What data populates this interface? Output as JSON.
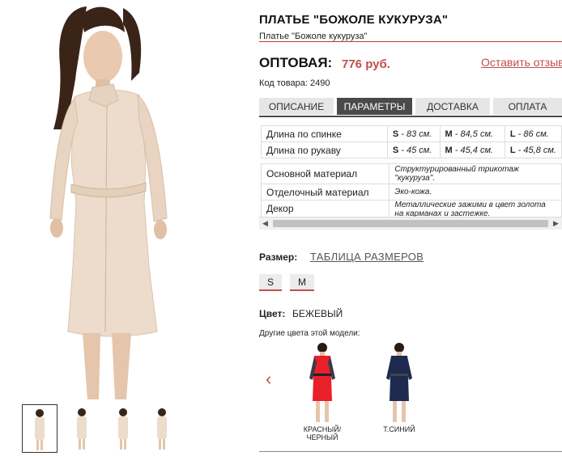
{
  "product": {
    "title": "ПЛАТЬЕ \"БОЖОЛЕ КУКУРУЗА\"",
    "subtitle": "Платье \"Божоле кукуруза\"",
    "price_label": "ОПТОВАЯ:",
    "price_value": "776 руб.",
    "review_link": "Оставить отзыв",
    "sku": "Код товара: 2490"
  },
  "tabs": [
    {
      "label": "ОПИСАНИЕ",
      "active": false
    },
    {
      "label": "ПАРАМЕТРЫ",
      "active": true
    },
    {
      "label": "ДОСТАВКА",
      "active": false
    },
    {
      "label": "ОПЛАТА",
      "active": false
    }
  ],
  "params": {
    "measurements": [
      {
        "label": "Длина по спинке",
        "s_size": "S",
        "s_val": " - 83 см.",
        "m_size": "M",
        "m_val": " - 84,5 см.",
        "l_size": "L",
        "l_val": " - 86 см."
      },
      {
        "label": "Длина по рукаву",
        "s_size": "S",
        "s_val": " - 45 см.",
        "m_size": "M",
        "m_val": " - 45,4 см.",
        "l_size": "L",
        "l_val": " - 45,8 см."
      }
    ],
    "details": [
      {
        "label": "Основной материал",
        "value": "Структурированный трикотаж \"кукуруза\"."
      },
      {
        "label": "Отделочный материал",
        "value": "Эко-кожа."
      },
      {
        "label": "Декор",
        "value": "Металлические зажими в цвет золота на карманах и застежке."
      }
    ]
  },
  "size": {
    "label": "Размер:",
    "table_link": "ТАБЛИЦА РАЗМЕРОВ",
    "options": [
      "S",
      "M"
    ]
  },
  "color": {
    "label": "Цвет:",
    "value": "БЕЖЕВЫЙ",
    "other_label": "Другие цвета этой модели:",
    "variants": [
      {
        "name": "КРАСНЫЙ/ ЧЕРНЫЙ",
        "dress_color": "#e8202a",
        "sleeve_color": "#3a3a4a"
      },
      {
        "name": "Т.СИНИЙ",
        "dress_color": "#1e2a4f",
        "sleeve_color": "#1e2a4f"
      }
    ]
  },
  "icons": {
    "prev": "chevron-left-icon",
    "scroll_left": "triangle-left-icon",
    "scroll_right": "triangle-right-icon"
  },
  "colors": {
    "accent": "#c0504d",
    "tab_active": "#4a4a4a",
    "dress": "#eddccb"
  }
}
